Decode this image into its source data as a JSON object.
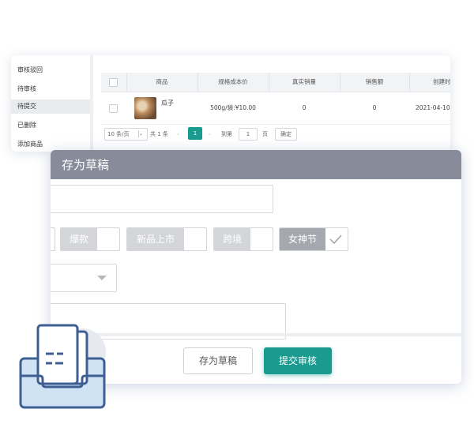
{
  "sidebar": {
    "items": [
      {
        "label": "审核驳回",
        "active": false
      },
      {
        "label": "待审核",
        "active": false
      },
      {
        "label": "待提交",
        "active": true
      },
      {
        "label": "已删除",
        "active": false
      },
      {
        "label": "添加商品",
        "active": false
      }
    ]
  },
  "table": {
    "headers": [
      "商品",
      "规格成本价",
      "真实销量",
      "销售额",
      "创建时间"
    ],
    "rows": [
      {
        "name": "瓜子",
        "spec_price": "500g/袋:¥10.00",
        "real_sales": "0",
        "sales_amount": "0",
        "created": "2021-04-10"
      }
    ]
  },
  "pagination": {
    "page_size": "10 条/页",
    "total": "共 1 条",
    "prev": "‹",
    "current_page": "1",
    "next": "›",
    "goto_label": "到第",
    "goto_value": "1",
    "page_unit": "页",
    "confirm": "确定"
  },
  "modal": {
    "title": "存为草稿",
    "tags": [
      {
        "label": "爆款",
        "selected": false
      },
      {
        "label": "新品上市",
        "selected": false
      },
      {
        "label": "跨境",
        "selected": false
      },
      {
        "label": "女神节",
        "selected": true
      }
    ],
    "buttons": {
      "draft": "存为草稿",
      "submit": "提交审核"
    }
  },
  "colors": {
    "accent": "#1a9b8f",
    "modal_header": "#878b9a",
    "illustration_blue": "#3f5f93",
    "illustration_light": "#cfe3f5"
  },
  "icons": {
    "illustration": "document-tray-icon",
    "check": "check-icon",
    "caret": "caret-down-icon"
  }
}
